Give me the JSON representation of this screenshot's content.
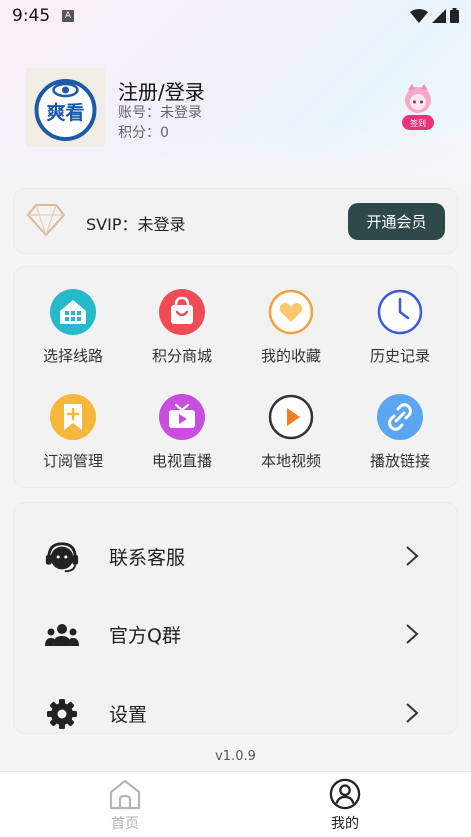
{
  "status_bar": {
    "time": "9:45",
    "badge": "A"
  },
  "profile": {
    "avatar_text": "爽看",
    "name": "注册/登录",
    "account": "账号：未登录",
    "points": "积分：0",
    "signin_label": "签到"
  },
  "svip": {
    "label": "SVIP：未登录",
    "button": "开通会员"
  },
  "grid": {
    "items": [
      {
        "label": "选择线路",
        "icon": "route-icon",
        "color": "#26b9c9"
      },
      {
        "label": "积分商城",
        "icon": "shop-bag-icon",
        "color": "#ef4c55"
      },
      {
        "label": "我的收藏",
        "icon": "heart-icon",
        "color": "#f0a146"
      },
      {
        "label": "历史记录",
        "icon": "clock-icon",
        "color": "#3a5bd9"
      },
      {
        "label": "订阅管理",
        "icon": "bookmark-plus-icon",
        "color": "#f6b73c"
      },
      {
        "label": "电视直播",
        "icon": "tv-icon",
        "color": "#c84ede"
      },
      {
        "label": "本地视频",
        "icon": "play-icon",
        "color": "#f2801f"
      },
      {
        "label": "播放链接",
        "icon": "link-icon",
        "color": "#5aa6ef"
      }
    ]
  },
  "list": {
    "items": [
      {
        "label": "联系客服",
        "icon": "headset-icon"
      },
      {
        "label": "官方Q群",
        "icon": "group-icon"
      },
      {
        "label": "设置",
        "icon": "gear-icon"
      }
    ]
  },
  "version": "v1.0.9",
  "nav": {
    "home": "首页",
    "mine": "我的",
    "active_color": "#222222",
    "inactive_color": "#b5b5b5"
  }
}
